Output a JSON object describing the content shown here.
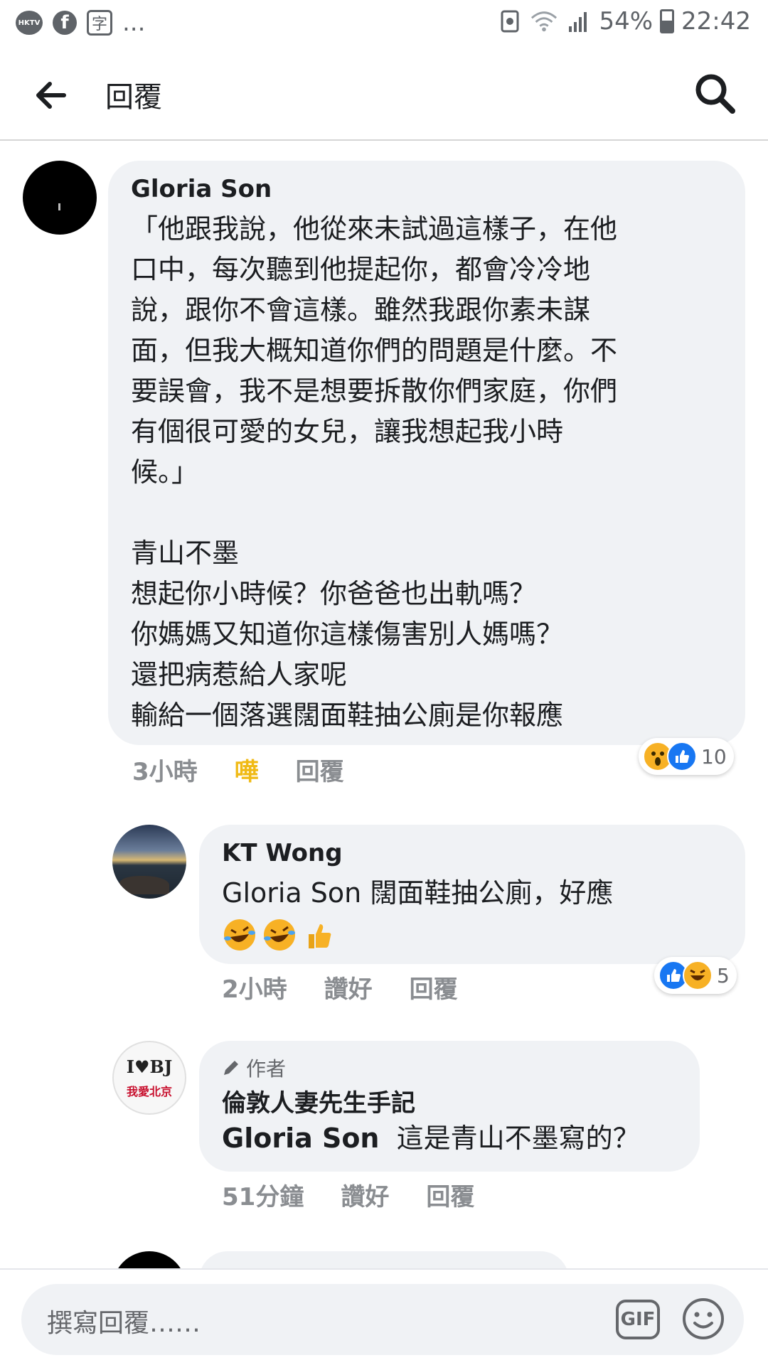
{
  "status_bar": {
    "battery": "54%",
    "time": "22:42",
    "hktv_label": "HKTV",
    "char_icon": "字",
    "more": "..."
  },
  "header": {
    "title": "回覆"
  },
  "comments": [
    {
      "author": "Gloria Son",
      "body": "「他跟我說，他從來未試過這樣子，在他\n口中，每次聽到他提起你，都會冷冷地\n說，跟你不會這樣。雖然我跟你素未謀\n面，但我大概知道你們的問題是什麼。不\n要誤會，我不是想要拆散你們家庭，你們\n有個很可愛的女兒，讓我想起我小時\n候。」\n\n青山不墨\n想起你小時候？你爸爸也出軌嗎？\n你媽媽又知道你這樣傷害別人媽嗎？\n還把病惹給人家呢\n輸給一個落選闊面鞋抽公廁是你報應",
      "time": "3小時",
      "reaction_action": "嘩",
      "reply": "回覆",
      "reaction_count": "10"
    },
    {
      "author": "KT Wong",
      "body": "Gloria Son 闊面鞋抽公廁，好應",
      "time": "2小時",
      "like": "讚好",
      "reply": "回覆",
      "reaction_count": "5"
    },
    {
      "author_tag": "作者",
      "author": "倫敦人妻先生手記",
      "mention": "Gloria Son",
      "body": "這是青山不墨寫的？",
      "time": "51分鐘",
      "like": "讚好",
      "reply": "回覆",
      "avatar_line1": "I♥BJ",
      "avatar_line2": "我愛北京"
    }
  ],
  "composer": {
    "placeholder": "撰寫回覆……",
    "gif": "GIF"
  },
  "colors": {
    "bubble": "#f0f2f5",
    "like_blue": "#1877f2",
    "wow_yellow": "#f0ba15",
    "meta_gray": "#8a8d91"
  }
}
